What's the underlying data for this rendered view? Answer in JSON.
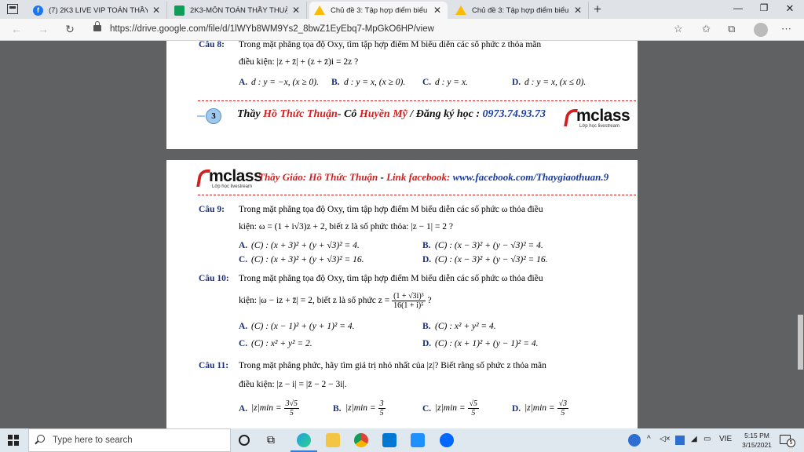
{
  "browser": {
    "tabs": [
      {
        "title": "(7) 2K3 LIVE VIP TOÁN THẦY THU…",
        "icon": "facebook-icon"
      },
      {
        "title": "2K3-MÔN TOÁN THẦY THUẬN - …",
        "icon": "google-sheets-icon"
      },
      {
        "title": "Chủ đề 3: Tập hợp điểm biểu diễ…",
        "icon": "google-drive-icon"
      },
      {
        "title": "Chủ đề 3: Tập hợp điểm biểu diễ…",
        "icon": "google-drive-icon"
      }
    ],
    "active_tab_index": 2,
    "url": "https://drive.google.com/file/d/1lWYb8WM9Ys2_8bwZ1EyEbq7-MpGkO6HP/view"
  },
  "page1": {
    "q8_label": "Câu 8:",
    "q8_line1": "Trong mặt phẳng tọa độ Oxy, tìm tập hợp điểm M  biểu diễn các số phức z  thỏa mãn",
    "q8_line2": "điều kiện: |z + z̄| + (z + z̄)i = 2z  ?",
    "q8_options": [
      {
        "label": "A.",
        "text": "d : y = −x,  (x ≥ 0)."
      },
      {
        "label": "B.",
        "text": "d : y = x,  (x ≥ 0)."
      },
      {
        "label": "C.",
        "text": "d : y = x."
      },
      {
        "label": "D.",
        "text": "d : y = x,  (x ≤ 0)."
      }
    ],
    "footer": {
      "page_number": "3",
      "teacher_prefix": "Thầy ",
      "teacher_name": "Hồ Thức Thuận",
      "co_prefix": "- Cô ",
      "co_name": "Huyền Mỹ",
      "register": " / Đăng ký học : ",
      "phone": "0973.74.93.73"
    }
  },
  "logo": {
    "word": "mclass",
    "sub": "Lớp học livestream"
  },
  "page2": {
    "header": {
      "teacher_label": "Thầy Giáo: Hồ Thức Thuận",
      "separator": " - ",
      "fb_label": "Link facebook:",
      "fb_url": " www.facebook.com/Thaygiaothuan.9"
    },
    "q9": {
      "label": "Câu 9:",
      "line1": "Trong mặt phẳng tọa độ Oxy, tìm tập hợp điểm M  biểu diễn các số phức ω  thỏa điều",
      "line2": "kiện:  ω = (1 + i√3)z + 2,  biết  z  là số phức thỏa: |z − 1| = 2  ?",
      "options": [
        {
          "label": "A.",
          "text": "(C) : (x + 3)² + (y + √3)² = 4."
        },
        {
          "label": "B.",
          "text": "(C) : (x − 3)² + (y − √3)² = 4."
        },
        {
          "label": "C.",
          "text": "(C) : (x + 3)² + (y + √3)² = 16."
        },
        {
          "label": "D.",
          "text": "(C) : (x − 3)² + (y − √3)² = 16."
        }
      ]
    },
    "q10": {
      "label": "Câu 10:",
      "line1": "Trong mặt phẳng tọa độ Oxy, tìm tập hợp điểm M  biểu diễn các số phức ω  thỏa điều",
      "line2_pre": "kiện: |ω − iz + z̄| = 2,  biết  z  là số phức  z = ",
      "line2_frac_num": "(1 + √3i)³",
      "line2_frac_den": "16(1 + i)⁵",
      "line2_post": "  ?",
      "options": [
        {
          "label": "A.",
          "text": "(C) : (x − 1)² + (y + 1)² = 4."
        },
        {
          "label": "B.",
          "text": "(C) : x² + y² = 4."
        },
        {
          "label": "C.",
          "text": "(C) : x² + y² = 2."
        },
        {
          "label": "D.",
          "text": "(C) : (x + 1)² + (y − 1)² = 4."
        }
      ]
    },
    "q11": {
      "label": "Câu 11:",
      "line1": "Trong mặt phẳng phức, hãy tìm giá trị nhỏ nhất của |z|? Biết rằng số phức  z  thỏa mãn",
      "line2": "điều kiện: |z − i| = |z̄ − 2 − 3i|.",
      "options": [
        {
          "label": "A.",
          "pre": "|z|min = ",
          "num": "3√5",
          "den": "5"
        },
        {
          "label": "B.",
          "pre": "|z|min = ",
          "num": "3",
          "den": "5"
        },
        {
          "label": "C.",
          "pre": "|z|min = ",
          "num": "√5",
          "den": "5"
        },
        {
          "label": "D.",
          "pre": "|z|min = ",
          "num": "√3",
          "den": "5"
        }
      ]
    }
  },
  "taskbar": {
    "search_placeholder": "Type here to search",
    "language": "VIE",
    "time": "5:15 PM",
    "date": "3/15/2021",
    "notification_count": "5"
  }
}
